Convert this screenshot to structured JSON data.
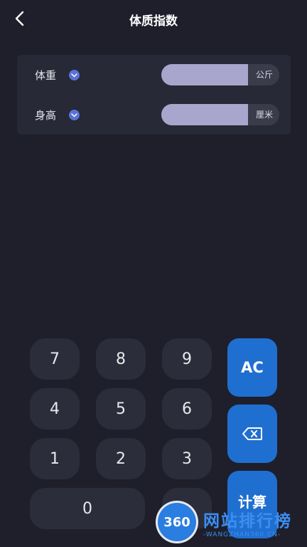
{
  "header": {
    "title": "体质指数"
  },
  "form": {
    "weight": {
      "label": "体重",
      "value": "",
      "unit": "公斤"
    },
    "height": {
      "label": "身高",
      "value": "",
      "unit": "厘米"
    }
  },
  "keypad": {
    "keys": [
      "7",
      "8",
      "9",
      "4",
      "5",
      "6",
      "1",
      "2",
      "3",
      "0"
    ],
    "clear_label": "AC",
    "calculate_label": "计算"
  },
  "watermark": {
    "logo_text": "360",
    "site": "网站排行榜",
    "domain": "-WANGZHAN360.CN-"
  },
  "colors": {
    "background": "#1e1f2b",
    "card": "#272936",
    "accent": "#1f6fd0",
    "input_fill": "#a8a6cc"
  }
}
